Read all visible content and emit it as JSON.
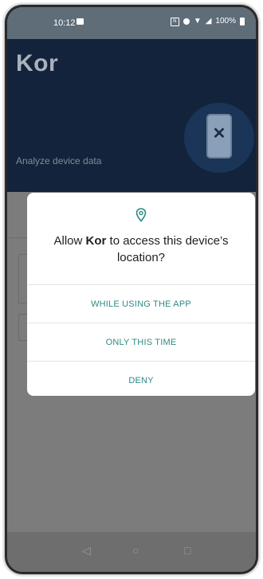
{
  "status_bar": {
    "time": "10:12",
    "battery": "100%"
  },
  "app": {
    "title": "Kor",
    "subtitle": "Analyze device data"
  },
  "dialog": {
    "title_pre": "Allow ",
    "app_name": "Kor",
    "title_post": " to access this device’s location?",
    "buttons": {
      "while_using": "WHILE USING THE APP",
      "only_this_time": "ONLY THIS TIME",
      "deny": "DENY"
    }
  },
  "nav": {
    "back": "◁",
    "home": "○",
    "recents": "□"
  },
  "colors": {
    "header": "#12233b",
    "accent": "#2e8a83",
    "scrim": "#7c7c7c"
  }
}
